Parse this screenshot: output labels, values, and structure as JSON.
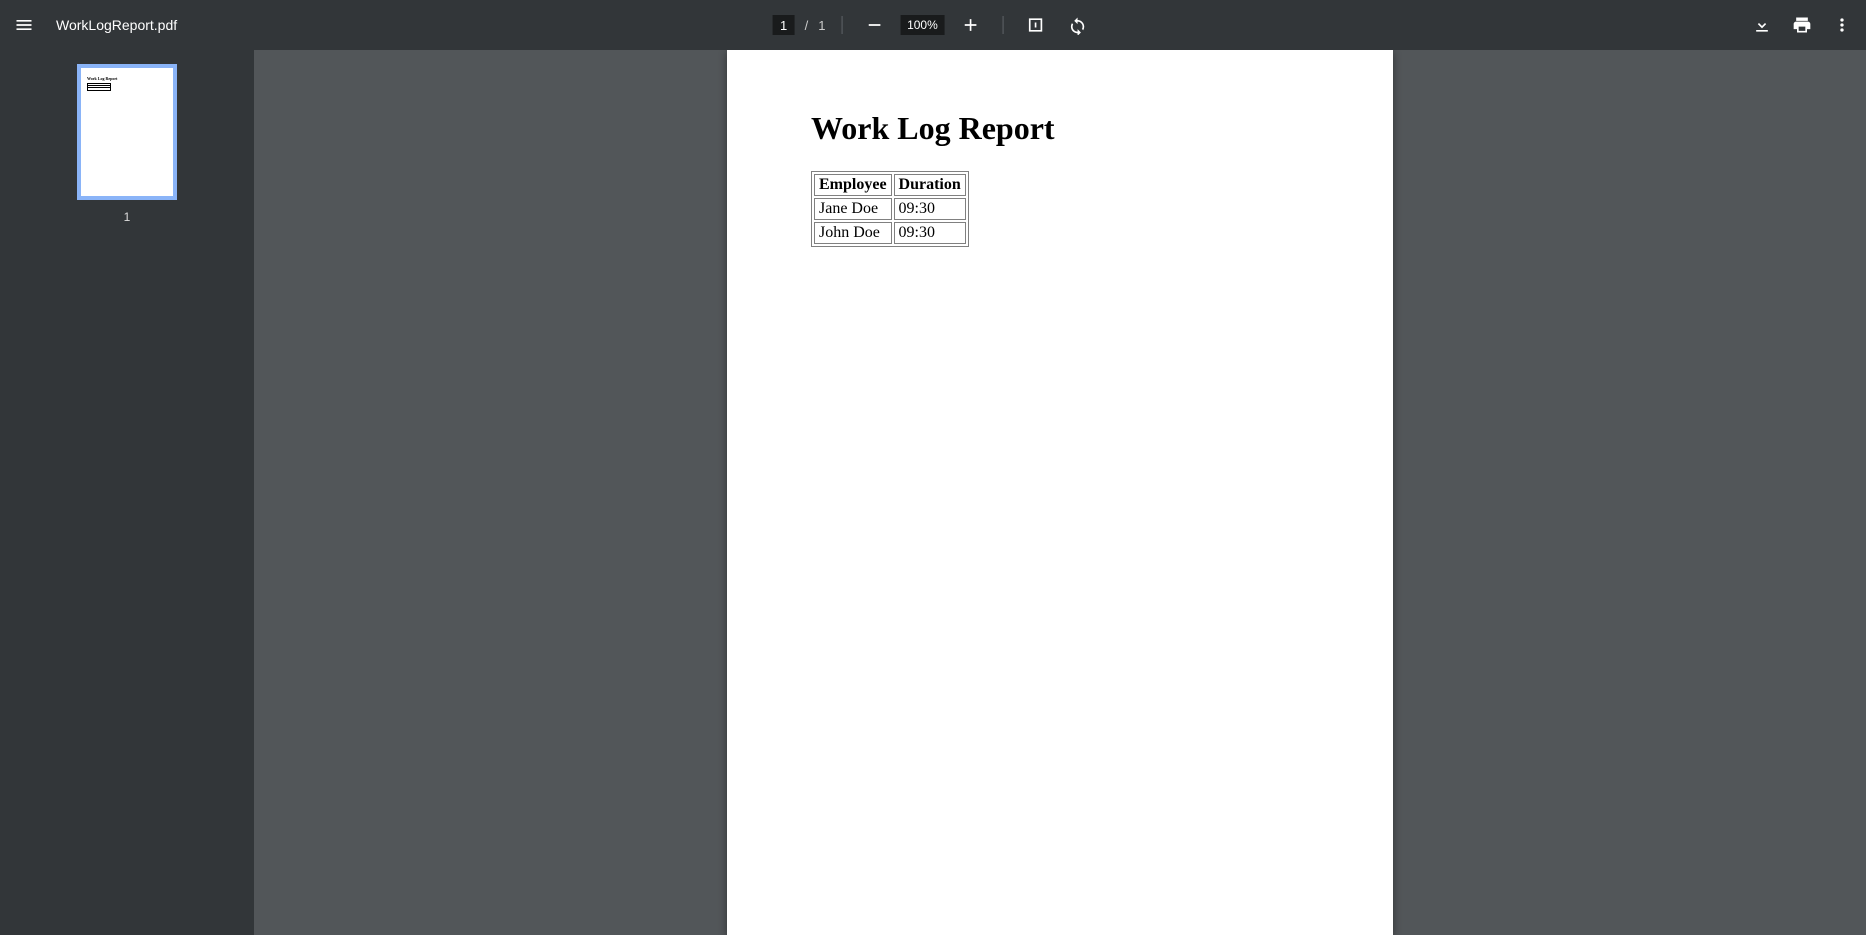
{
  "toolbar": {
    "filename": "WorkLogReport.pdf",
    "current_page": "1",
    "page_separator": "/",
    "total_pages": "1",
    "zoom_level": "100%"
  },
  "sidebar": {
    "thumbnails": [
      {
        "label": "1"
      }
    ]
  },
  "document": {
    "title": "Work Log Report",
    "table": {
      "headers": [
        "Employee",
        "Duration"
      ],
      "rows": [
        {
          "employee": "Jane Doe",
          "duration": "09:30"
        },
        {
          "employee": "John Doe",
          "duration": "09:30"
        }
      ]
    }
  }
}
